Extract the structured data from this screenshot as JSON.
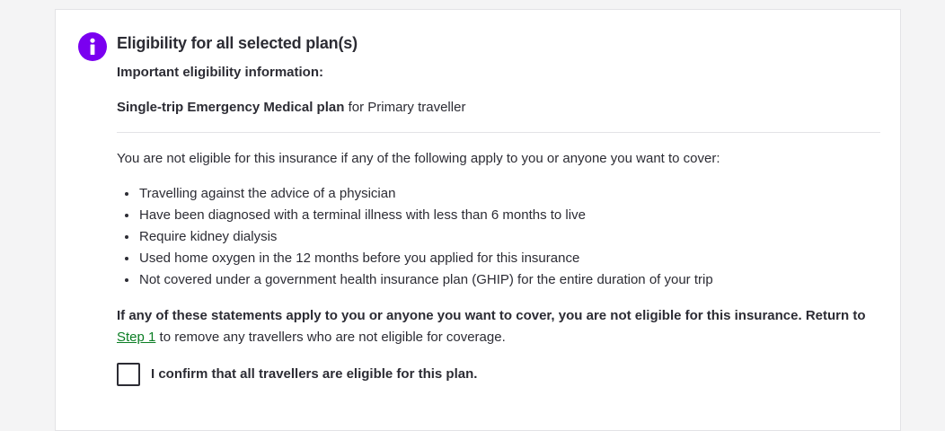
{
  "notice": {
    "icon": "info-icon",
    "accent_color": "#7a00f0",
    "title": "Eligibility for all selected plan(s)",
    "subtitle": "Important eligibility information:",
    "plan_name": "Single-trip Emergency Medical plan",
    "plan_for": "for Primary traveller",
    "intro": "You are not eligible for this insurance if any of the following apply to you or anyone you want to cover:",
    "conditions": [
      "Travelling against the advice of a physician",
      "Have been diagnosed with a terminal illness with less than 6 months to live",
      "Require kidney dialysis",
      "Used home oxygen in the 12 months before you applied for this insurance",
      "Not covered under a government health insurance plan (GHIP) for the entire duration of your trip"
    ],
    "warning_bold": "If any of these statements apply to you or anyone you want to cover, you are not eligible for this insurance. Return to",
    "warning_link": "Step 1",
    "link_color": "#0a7d23",
    "warning_rest": "to remove any travellers who are not eligible for coverage.",
    "confirm_label": "I confirm that all travellers are eligible for this plan.",
    "confirm_checked": false
  }
}
